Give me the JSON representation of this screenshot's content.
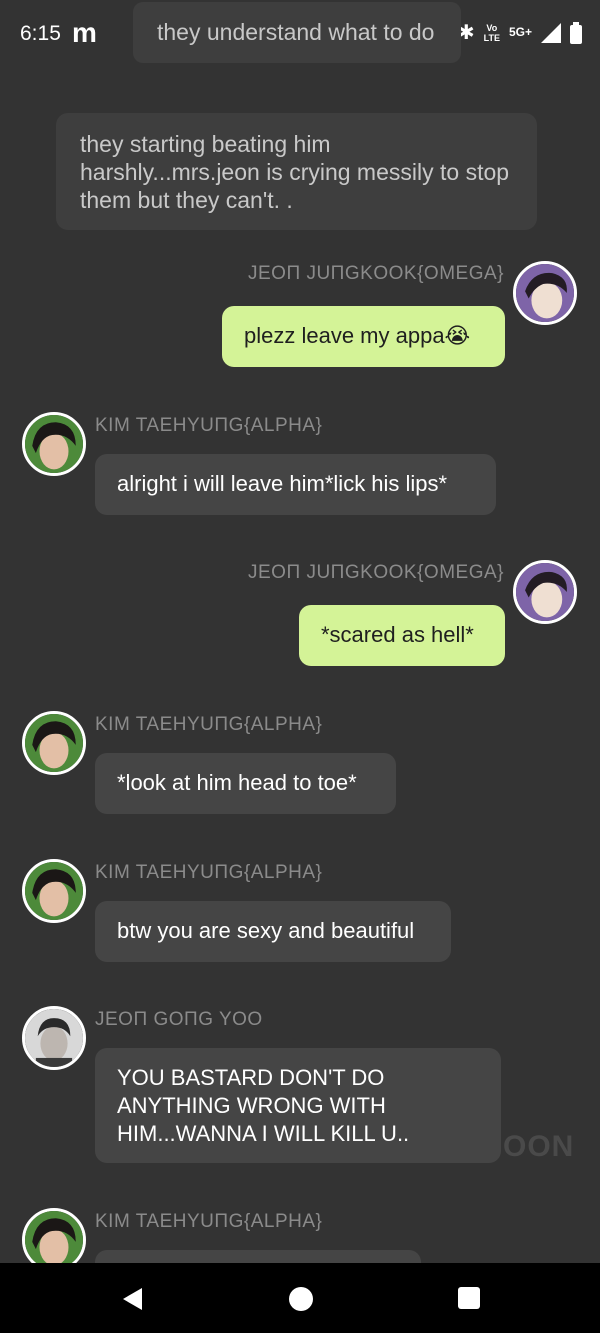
{
  "status_bar": {
    "time": "6:15",
    "app_logo": "m",
    "lte_label": "Vo\nLTE",
    "network": "5G+",
    "icons": [
      "bluetooth-icon",
      "signal-icon",
      "battery-icon"
    ]
  },
  "header_preview": "they understand what to do",
  "narration": "they starting beating him harshly...mrs.jeon is crying messily to stop them but they can't. .",
  "messages": [
    {
      "side": "right",
      "name": "JEOΠ JUΠGKOOK{OMEGA}",
      "text": "plezz leave my appa😭"
    },
    {
      "side": "left",
      "name": "KIM TAEHYUΠG{ALPHA}",
      "text": "alright i will leave him*lick his lips*"
    },
    {
      "side": "right",
      "name": "JEOΠ JUΠGKOOK{OMEGA}",
      "text": "*scared as hell*"
    },
    {
      "side": "left",
      "name": "KIM TAEHYUΠG{ALPHA}",
      "text": "*look at him head to toe*"
    },
    {
      "side": "left",
      "name": "KIM TAEHYUΠG{ALPHA}",
      "text": "btw you are sexy and beautiful"
    },
    {
      "side": "left",
      "name": "JEOΠ GOΠG YOO",
      "text": "YOU BASTARD DON'T DO ANYTHING WRONG WITH HIM...WANNA I WILL KILL U.."
    },
    {
      "side": "left",
      "name": "KIM TAEHYUΠG{ALPHA}",
      "text": ""
    }
  ],
  "watermark": "OON",
  "colors": {
    "background": "#333333",
    "left_bubble": "#454545",
    "right_bubble": "#d4f397",
    "name_text": "#8b8b8b"
  }
}
